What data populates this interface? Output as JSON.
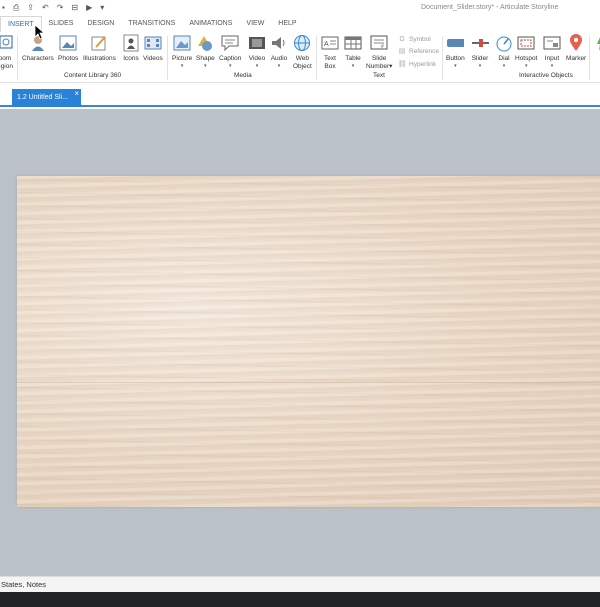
{
  "window": {
    "title": "Document_Slider.story* - Articulate Storyline"
  },
  "quick_access": {
    "icons": [
      "save-icon",
      "print-icon",
      "publish-icon",
      "undo-icon",
      "redo-icon",
      "align-icon",
      "preview-icon",
      "customize-icon"
    ]
  },
  "ribbon_tabs": [
    {
      "label": "INSERT",
      "active": true
    },
    {
      "label": "SLIDES",
      "active": false
    },
    {
      "label": "DESIGN",
      "active": false
    },
    {
      "label": "TRANSITIONS",
      "active": false
    },
    {
      "label": "ANIMATIONS",
      "active": false
    },
    {
      "label": "VIEW",
      "active": false
    },
    {
      "label": "HELP",
      "active": false
    }
  ],
  "ribbon": {
    "zoom_region": {
      "line1": "oom",
      "line2": "egion"
    },
    "content_library": {
      "group_label": "Content Library 360",
      "items": [
        "Characters",
        "Photos",
        "Illustrations",
        "Icons",
        "Videos"
      ]
    },
    "media": {
      "group_label": "Media",
      "items": [
        "Picture",
        "Shape",
        "Caption",
        "Video",
        "Audio"
      ],
      "web_object": {
        "line1": "Web",
        "line2": "Object"
      }
    },
    "text": {
      "group_label": "Text",
      "text_box": {
        "line1": "Text",
        "line2": "Box"
      },
      "table": "Table",
      "slide_number": {
        "line1": "Slide",
        "line2": "Number"
      },
      "small_items": [
        "Symbol",
        "Reference",
        "Hyperlink"
      ]
    },
    "interactive_objects": {
      "group_label": "Interactive Objects",
      "items": [
        "Button",
        "Slider",
        "Dial",
        "Hotspot",
        "Input",
        "Marker"
      ]
    }
  },
  "document_tab": {
    "label": "1.2 Untitled Sli...",
    "close": "×"
  },
  "status_bar": {
    "text": "States, Notes"
  },
  "colors": {
    "accent": "#2a82d6",
    "canvas": "#bac1c7",
    "taskbar": "#222326"
  }
}
